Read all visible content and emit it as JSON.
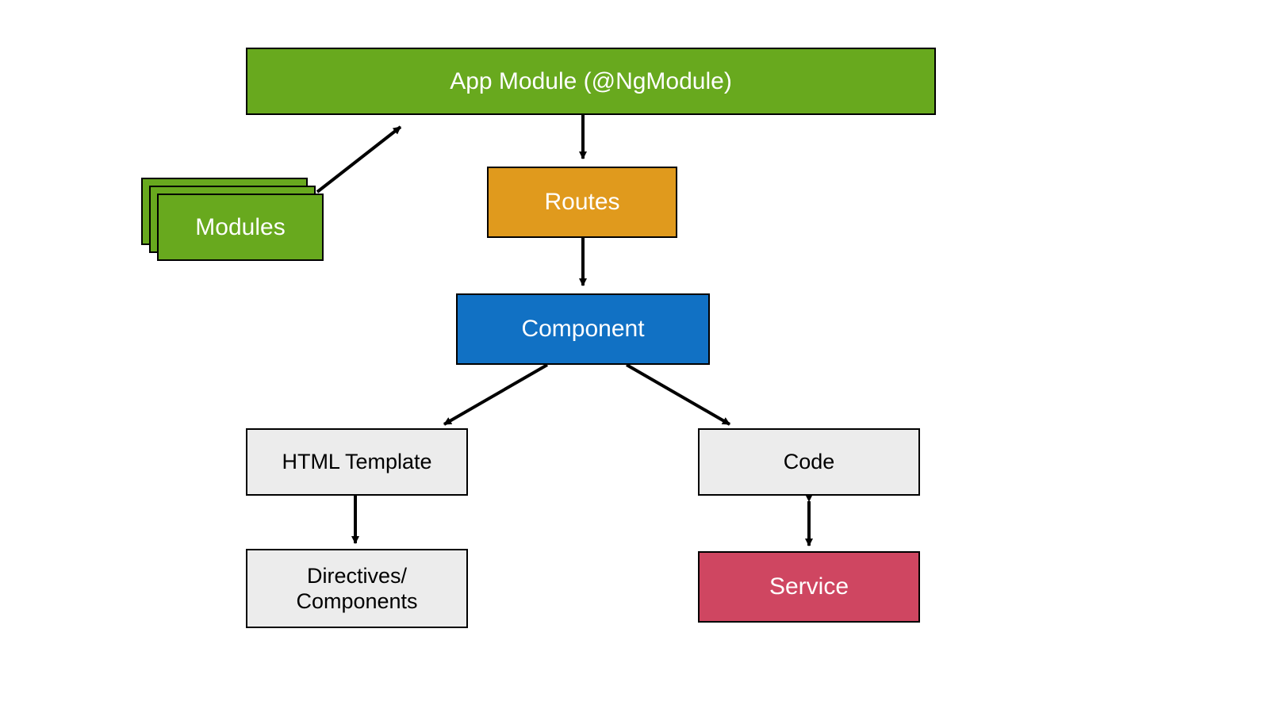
{
  "colors": {
    "green": "#68a91e",
    "orange": "#e09a1d",
    "blue": "#1171c4",
    "grey": "#ececec",
    "red": "#cf4661",
    "black": "#000000",
    "white": "#ffffff"
  },
  "nodes": {
    "app_module": {
      "label": "App Module (@NgModule)",
      "fill": "green",
      "text": "white",
      "fs": 30
    },
    "modules": {
      "label": "Modules",
      "fill": "green",
      "text": "white",
      "fs": 30
    },
    "routes": {
      "label": "Routes",
      "fill": "orange",
      "text": "white",
      "fs": 30
    },
    "component": {
      "label": "Component",
      "fill": "blue",
      "text": "white",
      "fs": 30
    },
    "html_tmpl": {
      "label": "HTML Template",
      "fill": "grey",
      "text": "black",
      "fs": 27
    },
    "code": {
      "label": "Code",
      "fill": "grey",
      "text": "black",
      "fs": 27
    },
    "directives": {
      "label": "Directives/\nComponents",
      "fill": "grey",
      "text": "black",
      "fs": 27
    },
    "service": {
      "label": "Service",
      "fill": "red",
      "text": "white",
      "fs": 30
    }
  }
}
